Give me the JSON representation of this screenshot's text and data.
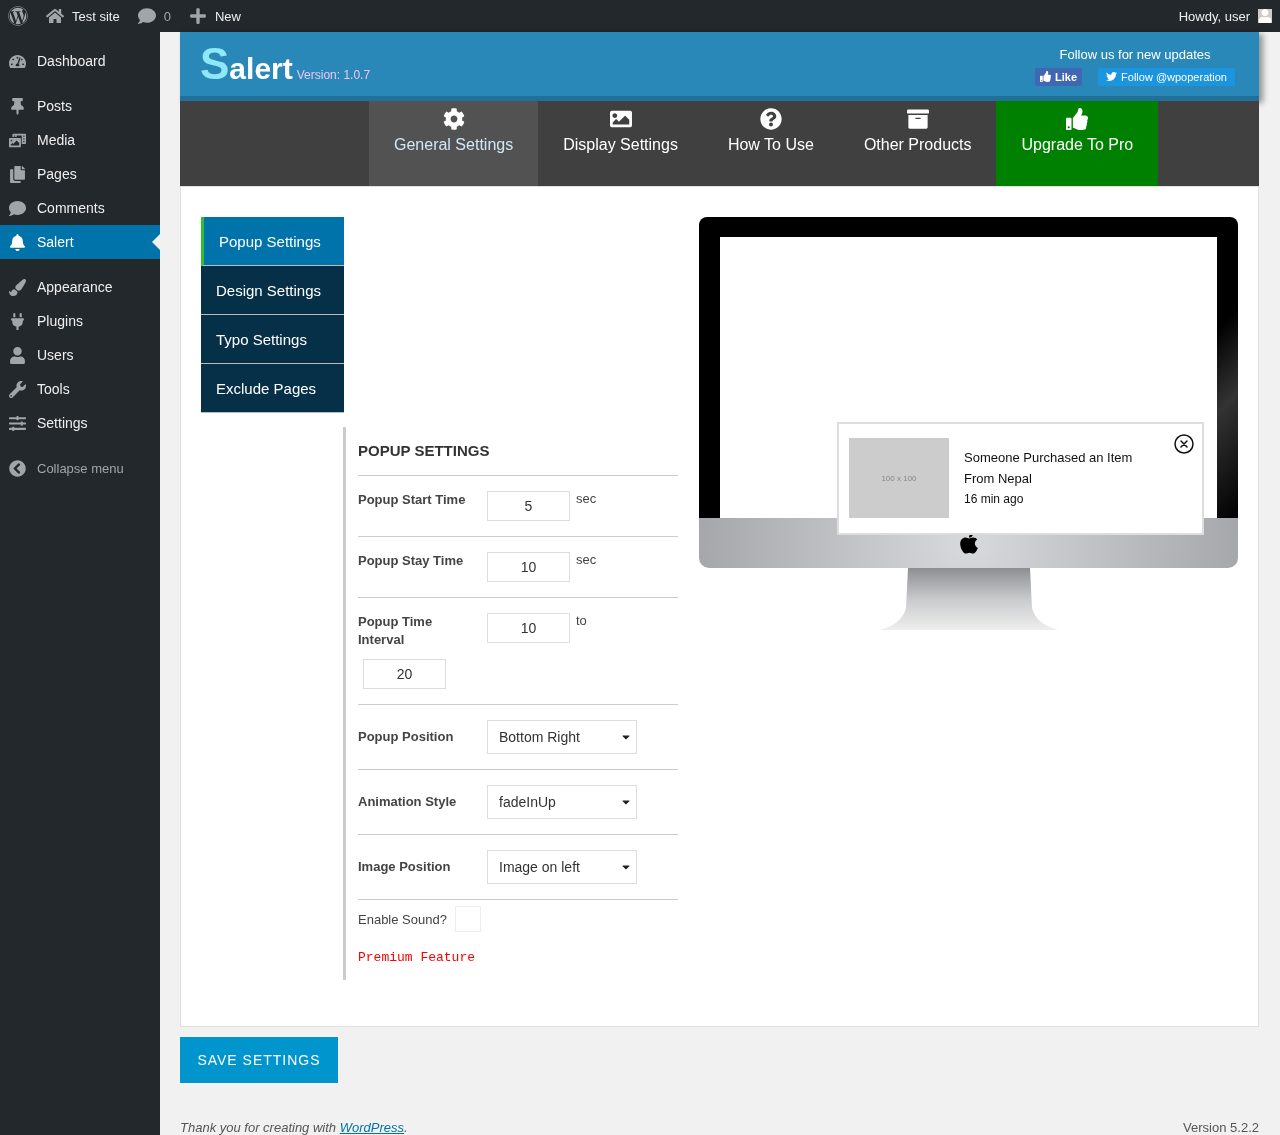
{
  "admin_bar": {
    "site": "Test site",
    "comments": "0",
    "new": "New",
    "greeting": "Howdy, user"
  },
  "sidebar": {
    "groups": [
      {
        "items": [
          {
            "label": "Dashboard",
            "selected": false
          }
        ]
      },
      {
        "items": [
          {
            "label": "Posts",
            "selected": false
          },
          {
            "label": "Media",
            "selected": false
          },
          {
            "label": "Pages",
            "selected": false
          },
          {
            "label": "Comments",
            "selected": false
          },
          {
            "label": "Salert",
            "selected": true
          }
        ]
      },
      {
        "items": [
          {
            "label": "Appearance",
            "selected": false
          },
          {
            "label": "Plugins",
            "selected": false
          },
          {
            "label": "Users",
            "selected": false
          },
          {
            "label": "Tools",
            "selected": false
          },
          {
            "label": "Settings",
            "selected": false
          }
        ]
      }
    ],
    "collapse": "Collapse menu"
  },
  "plugin_header": {
    "logo_initial": "S",
    "logo_rest": "alert",
    "version": "Version: 1.0.7",
    "follow_text": "Follow us for new updates",
    "like": "Like",
    "follow": "Follow @wpoperation"
  },
  "nav_tabs": [
    {
      "label": "General Settings",
      "selected": true,
      "kind": "normal"
    },
    {
      "label": "Display Settings",
      "selected": false,
      "kind": "normal"
    },
    {
      "label": "How To Use",
      "selected": false,
      "kind": "normal"
    },
    {
      "label": "Other Products",
      "selected": false,
      "kind": "normal"
    },
    {
      "label": "Upgrade To Pro",
      "selected": false,
      "kind": "pro"
    }
  ],
  "submenu": [
    {
      "label": "Popup Settings",
      "selected": true
    },
    {
      "label": "Design Settings",
      "selected": false
    },
    {
      "label": "Typo Settings",
      "selected": false
    },
    {
      "label": "Exclude Pages",
      "selected": false
    }
  ],
  "form": {
    "title": "POPUP SETTINGS",
    "rows": [
      {
        "kind": "input",
        "label": "Popup Start Time",
        "value": "5",
        "unit": "sec"
      },
      {
        "kind": "input",
        "label": "Popup Stay Time",
        "value": "10",
        "unit": "sec"
      },
      {
        "kind": "range",
        "label": "Popup Time Interval",
        "value": "10",
        "unit": "to",
        "value2": "20"
      },
      {
        "kind": "select",
        "label": "Popup Position",
        "value": "Bottom Right"
      },
      {
        "kind": "select",
        "label": "Animation Style",
        "value": "fadeInUp"
      },
      {
        "kind": "select",
        "label": "Image Position",
        "value": "Image on left"
      }
    ],
    "sound": {
      "label": "Enable Sound?",
      "checked": false
    },
    "premium": "Premium Feature"
  },
  "preview": {
    "image_label": "100 x 100",
    "title": "Someone Purchased an Item",
    "location": "From Nepal",
    "time": "16 min ago"
  },
  "save": "SAVE SETTINGS",
  "footer": {
    "thanks": "Thank you for creating with ",
    "link": "WordPress",
    "after": ".",
    "version": "Version 5.2.2"
  }
}
